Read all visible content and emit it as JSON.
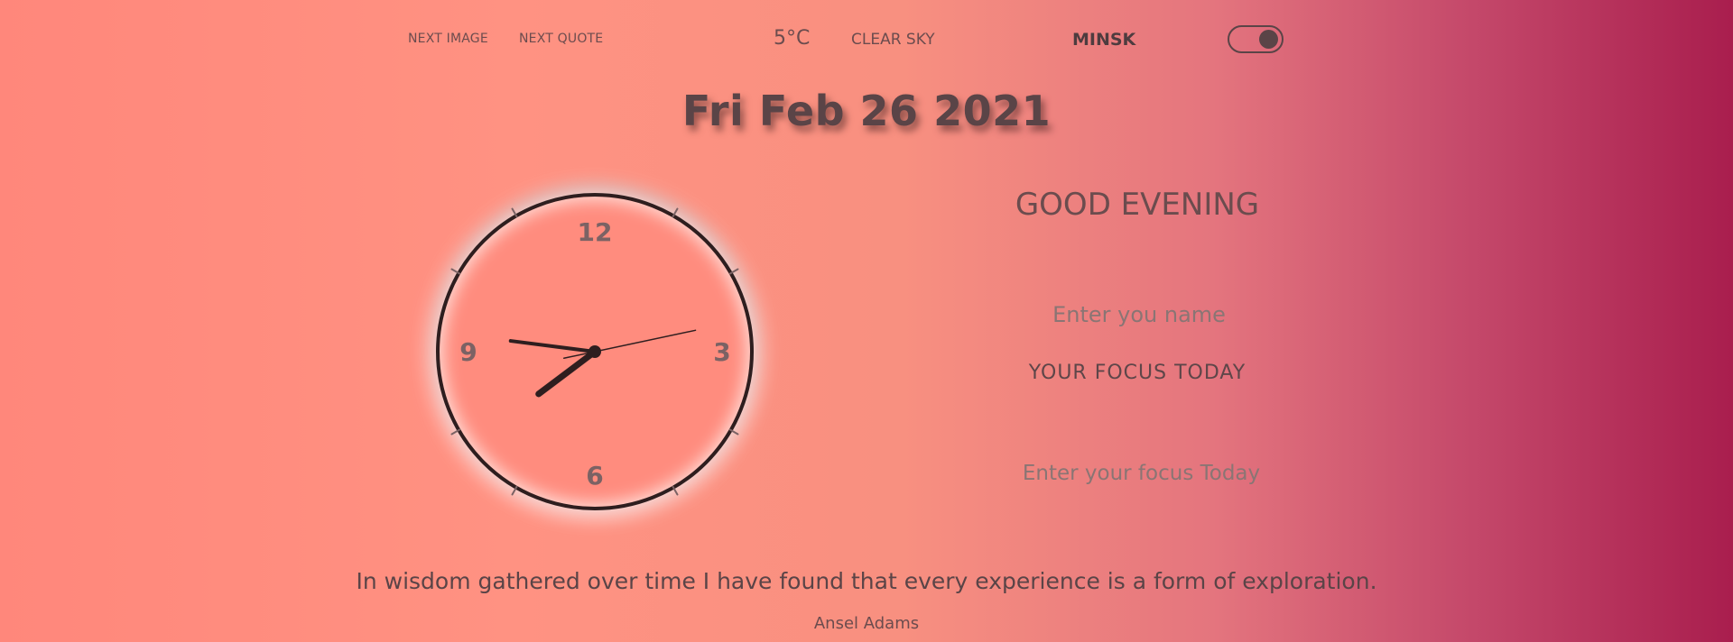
{
  "nav": {
    "next_image": "NEXT IMAGE",
    "next_quote": "NEXT QUOTE"
  },
  "weather": {
    "temperature": "5°C",
    "description": "CLEAR SKY",
    "city": "MINSK"
  },
  "theme_toggle": {
    "state": "on"
  },
  "date": "Fri Feb 26 2021",
  "clock": {
    "numerals": {
      "twelve": "12",
      "three": "3",
      "six": "6",
      "nine": "9"
    },
    "time": {
      "hours": 7,
      "minutes": 46,
      "seconds": 13
    }
  },
  "greeting": "GOOD EVENING",
  "name_input": {
    "placeholder": "Enter you name",
    "value": ""
  },
  "focus": {
    "title": "YOUR FOCUS TODAY",
    "placeholder": "Enter your focus Today",
    "value": ""
  },
  "quote": {
    "text": "In wisdom gathered over time I have found that every experience is a form of exploration.",
    "author": "Ansel Adams"
  },
  "colors": {
    "gradient_start": "#ff877b",
    "gradient_end": "#a91e4e",
    "text": "#5a4447",
    "clock_border": "#2e1e1f"
  }
}
